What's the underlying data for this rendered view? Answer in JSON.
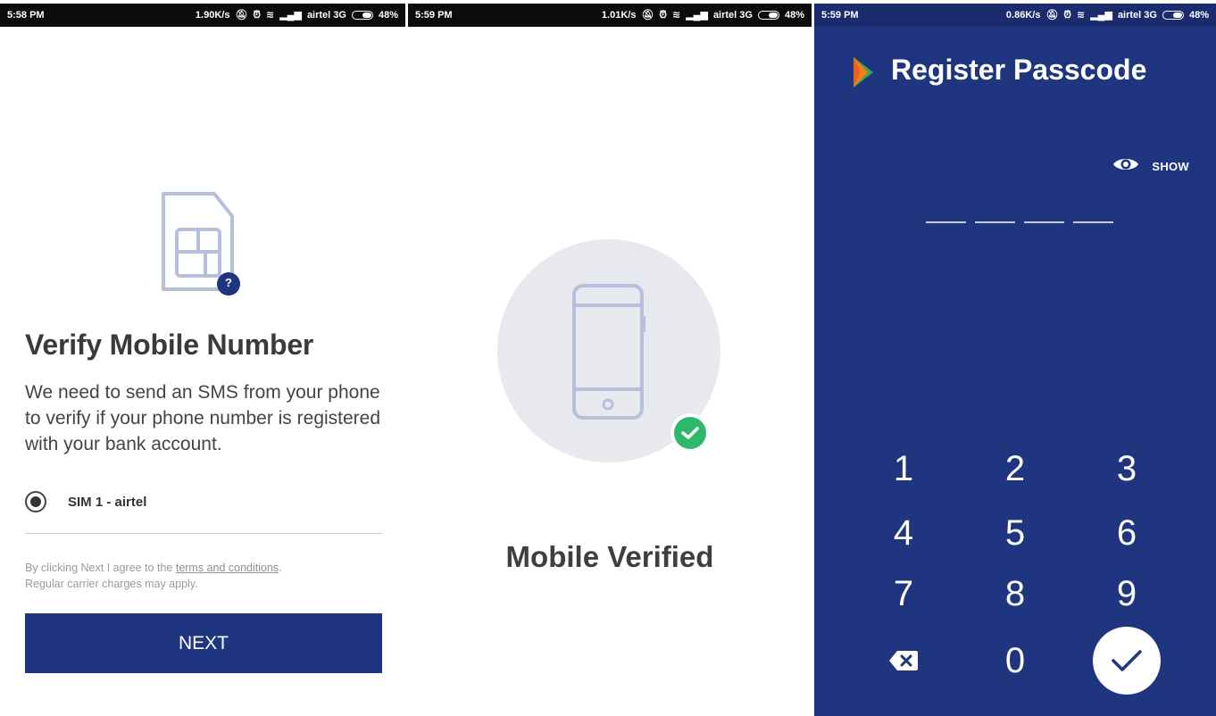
{
  "screen1": {
    "status": {
      "time": "5:58 PM",
      "speed": "1.90K/s",
      "carrier": "airtel 3G",
      "battery": "48%"
    },
    "title": "Verify Mobile Number",
    "description": "We need to send an SMS from your phone to verify if your phone number is registered with your bank account.",
    "sim_option": "SIM 1 - airtel",
    "terms_prefix": "By clicking Next I agree to the ",
    "terms_link": "terms and conditions",
    "terms_suffix": ".",
    "terms_line2": "Regular carrier charges may apply.",
    "next_label": "NEXT",
    "sim_badge": "?"
  },
  "screen2": {
    "status": {
      "time": "5:59 PM",
      "speed": "1.01K/s",
      "carrier": "airtel 3G",
      "battery": "48%"
    },
    "title": "Mobile Verified"
  },
  "screen3": {
    "status": {
      "time": "5:59 PM",
      "speed": "0.86K/s",
      "carrier": "airtel 3G",
      "battery": "48%"
    },
    "title": "Register Passcode",
    "show_label": "SHOW",
    "keys": [
      "1",
      "2",
      "3",
      "4",
      "5",
      "6",
      "7",
      "8",
      "9",
      "0"
    ]
  },
  "colors": {
    "primary": "#1f3580",
    "success": "#2eb86a",
    "logo_orange": "#f47c20",
    "logo_green": "#36a94a"
  }
}
